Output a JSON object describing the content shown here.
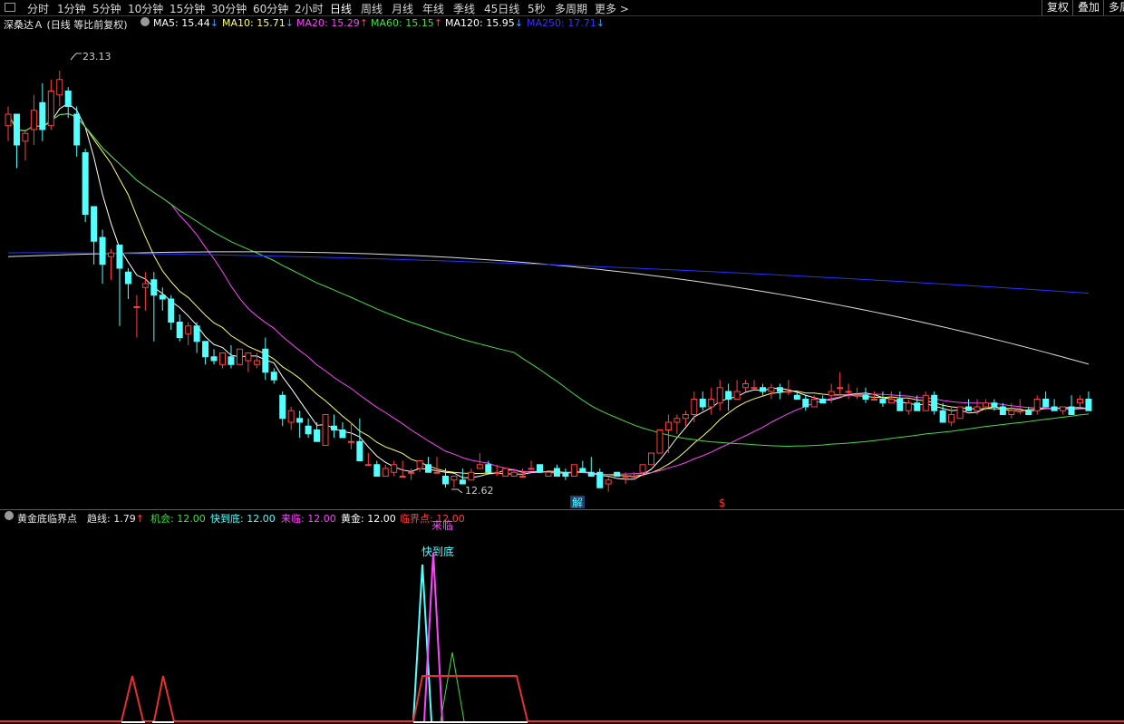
{
  "toolbar": {
    "periods": [
      "分时",
      "1分钟",
      "5分钟",
      "10分钟",
      "15分钟",
      "30分钟",
      "60分钟",
      "2小时",
      "日线",
      "周线",
      "月线",
      "年线",
      "季线",
      "45日线",
      "5秒",
      "多周期",
      "更多 >"
    ],
    "active_period": "日线",
    "right_buttons": [
      "复权",
      "叠加",
      "多周"
    ]
  },
  "main_legend": {
    "title": "深桑达Ａ (日线 等比前复权)",
    "ma5": {
      "label": "MA5: 15.44",
      "dir": "↓",
      "color": "#ffffff"
    },
    "ma10": {
      "label": "MA10: 15.71",
      "dir": "↓",
      "color": "#ffff66"
    },
    "ma20": {
      "label": "MA20: 15.29",
      "dir": "↑",
      "color": "#ff44ff"
    },
    "ma60": {
      "label": "MA60: 15.15",
      "dir": "↑",
      "color": "#44dd44"
    },
    "ma120": {
      "label": "MA120: 15.95",
      "dir": "↓",
      "color": "#ffffff"
    },
    "ma250": {
      "label": "MA250: 17.71",
      "dir": "↓",
      "color": "#3333ff"
    }
  },
  "price_annotations": {
    "high": "23.13",
    "low": "12.62"
  },
  "signal_markers": {
    "jie": "解",
    "dollar": "$"
  },
  "indicator_legend": {
    "title": "黄金底临界点",
    "trend": {
      "label": "趋线: 1.79",
      "dir": "↑"
    },
    "chance": "机会: 12.00",
    "quick_bottom": "快到底: 12.00",
    "coming": "来临: 12.00",
    "gold": "黄金: 12.00",
    "critical": "临界点: 12.00"
  },
  "indicator_labels": {
    "quick_bottom": "快到底",
    "coming": "来临"
  },
  "colors": {
    "bull": "#ff4040",
    "bear": "#54ffff",
    "ma5": "#ffffff",
    "ma10": "#ffff66",
    "ma20": "#ff44ff",
    "ma60": "#44dd44",
    "ma120": "#dddddd",
    "ma250": "#2233ff",
    "quick_bottom": "#54ffff",
    "coming": "#ff44ff",
    "chance": "#44dd44",
    "critical": "#e83030"
  },
  "chart_data": {
    "type": "candlestick",
    "title": "深桑达Ａ (日线 等比前复权)",
    "y_range": [
      12.0,
      24.0
    ],
    "candles": [
      [
        21.7,
        22.2,
        21.3,
        22.0
      ],
      [
        22.0,
        22.0,
        20.6,
        21.2
      ],
      [
        21.3,
        21.6,
        20.8,
        21.5
      ],
      [
        21.6,
        22.5,
        21.2,
        22.1
      ],
      [
        22.3,
        22.8,
        21.3,
        21.6
      ],
      [
        21.7,
        22.9,
        21.6,
        22.6
      ],
      [
        22.5,
        23.13,
        22.2,
        22.9
      ],
      [
        22.6,
        22.7,
        21.9,
        22.2
      ],
      [
        22.0,
        22.2,
        20.9,
        21.2
      ],
      [
        21.0,
        21.1,
        19.2,
        19.4
      ],
      [
        19.6,
        19.6,
        18.1,
        18.7
      ],
      [
        18.8,
        19.0,
        17.6,
        18.1
      ],
      [
        18.3,
        18.5,
        17.7,
        18.4
      ],
      [
        18.6,
        18.6,
        16.5,
        18.0
      ],
      [
        17.9,
        18.0,
        17.2,
        17.6
      ],
      [
        17.0,
        17.3,
        16.2,
        17.0
      ],
      [
        17.5,
        17.9,
        16.9,
        17.6
      ],
      [
        17.7,
        17.9,
        16.1,
        17.3
      ],
      [
        17.3,
        17.5,
        16.9,
        17.2
      ],
      [
        17.2,
        17.3,
        16.4,
        16.6
      ],
      [
        16.6,
        16.8,
        16.1,
        16.2
      ],
      [
        16.3,
        16.6,
        16.0,
        16.5
      ],
      [
        16.5,
        16.6,
        15.8,
        16.1
      ],
      [
        16.1,
        16.1,
        15.5,
        15.7
      ],
      [
        15.7,
        15.9,
        15.5,
        15.6
      ],
      [
        15.5,
        15.8,
        15.4,
        15.8
      ],
      [
        15.7,
        16.0,
        15.4,
        15.5
      ],
      [
        15.5,
        15.9,
        15.5,
        15.9
      ],
      [
        15.6,
        15.8,
        15.3,
        15.8
      ],
      [
        15.5,
        15.8,
        15.4,
        15.6
      ],
      [
        15.9,
        16.2,
        15.1,
        15.3
      ],
      [
        15.3,
        15.4,
        15.0,
        15.1
      ],
      [
        14.7,
        14.8,
        13.9,
        14.1
      ],
      [
        14.0,
        14.4,
        13.8,
        14.3
      ],
      [
        14.1,
        14.3,
        13.6,
        14.0
      ],
      [
        13.9,
        14.1,
        13.6,
        13.7
      ],
      [
        13.8,
        14.0,
        13.5,
        13.5
      ],
      [
        13.4,
        14.2,
        13.4,
        14.2
      ],
      [
        13.9,
        14.2,
        13.6,
        13.8
      ],
      [
        13.8,
        14.0,
        13.6,
        13.6
      ],
      [
        13.5,
        14.0,
        13.3,
        13.5
      ],
      [
        13.5,
        14.1,
        13.1,
        13.0
      ],
      [
        12.9,
        13.2,
        12.9,
        12.9
      ],
      [
        12.9,
        13.0,
        12.6,
        12.6
      ],
      [
        12.6,
        12.9,
        12.62,
        12.8
      ],
      [
        12.7,
        13.0,
        12.6,
        12.9
      ],
      [
        12.6,
        13.0,
        12.6,
        12.6
      ],
      [
        12.7,
        12.8,
        12.5,
        12.7
      ],
      [
        12.8,
        13.0,
        12.7,
        13.0
      ],
      [
        12.9,
        13.1,
        12.7,
        12.7
      ],
      [
        12.7,
        13.1,
        12.7,
        12.7
      ],
      [
        12.6,
        12.8,
        12.3,
        12.4
      ],
      [
        12.5,
        12.6,
        12.3,
        12.6
      ],
      [
        12.5,
        12.8,
        12.4,
        12.4
      ],
      [
        12.5,
        12.8,
        12.5,
        12.7
      ],
      [
        12.8,
        13.2,
        12.8,
        12.9
      ],
      [
        12.9,
        13.0,
        12.7,
        12.7
      ],
      [
        12.7,
        12.9,
        12.6,
        12.7
      ],
      [
        12.6,
        12.8,
        12.6,
        12.8
      ],
      [
        12.6,
        12.8,
        12.7,
        12.7
      ],
      [
        12.6,
        12.8,
        12.6,
        12.6
      ],
      [
        12.8,
        13.0,
        12.8,
        12.8
      ],
      [
        12.9,
        12.9,
        12.7,
        12.7
      ],
      [
        12.6,
        12.7,
        12.6,
        12.7
      ],
      [
        12.8,
        12.9,
        12.6,
        12.6
      ],
      [
        12.7,
        12.8,
        12.5,
        12.6
      ],
      [
        12.6,
        12.9,
        12.6,
        12.9
      ],
      [
        12.8,
        13.0,
        12.7,
        12.7
      ],
      [
        12.7,
        13.1,
        12.7,
        12.6
      ],
      [
        12.7,
        12.8,
        12.3,
        12.3
      ],
      [
        12.4,
        12.6,
        12.2,
        12.5
      ],
      [
        12.7,
        12.7,
        12.6,
        12.6
      ],
      [
        12.6,
        12.7,
        12.4,
        12.6
      ],
      [
        12.6,
        12.7,
        12.5,
        12.6
      ],
      [
        12.7,
        12.9,
        12.6,
        12.9
      ],
      [
        12.9,
        13.0,
        12.9,
        13.2
      ],
      [
        13.2,
        13.8,
        13.2,
        13.8
      ],
      [
        13.8,
        14.2,
        13.2,
        14.0
      ],
      [
        14.0,
        14.2,
        13.7,
        14.1
      ],
      [
        14.1,
        14.3,
        13.9,
        14.2
      ],
      [
        14.2,
        14.8,
        14.0,
        14.6
      ],
      [
        14.6,
        14.8,
        14.3,
        14.4
      ],
      [
        14.4,
        14.9,
        14.2,
        14.6
      ],
      [
        14.5,
        15.1,
        14.3,
        14.9
      ],
      [
        14.8,
        15.0,
        14.3,
        14.6
      ],
      [
        14.6,
        15.1,
        14.6,
        14.8
      ],
      [
        14.9,
        15.1,
        14.8,
        15.0
      ],
      [
        14.9,
        15.1,
        14.9,
        14.9
      ],
      [
        14.9,
        15.0,
        14.7,
        14.8
      ],
      [
        14.8,
        15.0,
        14.6,
        14.9
      ],
      [
        14.9,
        15.0,
        14.6,
        14.8
      ],
      [
        14.8,
        15.1,
        14.7,
        14.8
      ],
      [
        14.7,
        14.8,
        14.6,
        14.6
      ],
      [
        14.6,
        14.7,
        14.3,
        14.4
      ],
      [
        14.4,
        14.7,
        14.4,
        14.6
      ],
      [
        14.6,
        14.7,
        14.5,
        14.5
      ],
      [
        14.7,
        15.0,
        14.5,
        14.8
      ],
      [
        14.9,
        15.3,
        14.7,
        14.9
      ],
      [
        14.8,
        15.0,
        14.6,
        14.8
      ],
      [
        14.7,
        14.9,
        14.6,
        14.7
      ],
      [
        14.7,
        14.9,
        14.5,
        14.6
      ],
      [
        14.6,
        14.8,
        14.6,
        14.6
      ],
      [
        14.6,
        14.8,
        14.4,
        14.5
      ],
      [
        14.5,
        14.8,
        14.5,
        14.6
      ],
      [
        14.6,
        14.8,
        14.3,
        14.3
      ],
      [
        14.3,
        14.6,
        14.2,
        14.5
      ],
      [
        14.5,
        14.7,
        14.3,
        14.3
      ],
      [
        14.3,
        14.8,
        14.3,
        14.7
      ],
      [
        14.7,
        14.8,
        14.2,
        14.3
      ],
      [
        14.3,
        14.5,
        14.0,
        14.0
      ],
      [
        14.0,
        14.4,
        13.9,
        14.2
      ],
      [
        14.1,
        14.4,
        14.1,
        14.4
      ],
      [
        14.4,
        14.6,
        14.3,
        14.3
      ],
      [
        14.3,
        14.6,
        14.2,
        14.4
      ],
      [
        14.4,
        14.6,
        14.3,
        14.5
      ],
      [
        14.5,
        14.6,
        14.3,
        14.4
      ],
      [
        14.4,
        14.5,
        14.2,
        14.2
      ],
      [
        14.2,
        14.5,
        14.1,
        14.3
      ],
      [
        14.3,
        14.6,
        14.2,
        14.3
      ],
      [
        14.3,
        14.4,
        14.2,
        14.2
      ],
      [
        14.3,
        14.7,
        14.2,
        14.6
      ],
      [
        14.6,
        14.8,
        14.5,
        14.4
      ],
      [
        14.4,
        14.6,
        14.3,
        14.3
      ],
      [
        14.3,
        14.4,
        14.2,
        14.4
      ],
      [
        14.4,
        14.7,
        14.3,
        14.2
      ],
      [
        14.5,
        14.7,
        14.4,
        14.6
      ],
      [
        14.6,
        14.8,
        14.3,
        14.3
      ]
    ],
    "moving_averages": [
      {
        "name": "MA5",
        "value": 15.44
      },
      {
        "name": "MA10",
        "value": 15.71
      },
      {
        "name": "MA20",
        "value": 15.29
      },
      {
        "name": "MA60",
        "value": 15.15
      },
      {
        "name": "MA120",
        "value": 15.95
      },
      {
        "name": "MA250",
        "value": 17.71
      }
    ],
    "indicator": {
      "name": "黄金底临界点",
      "series": [
        {
          "name": "趋线",
          "value": 1.79
        },
        {
          "name": "机会",
          "value": 12.0
        },
        {
          "name": "快到底",
          "value": 12.0
        },
        {
          "name": "来临",
          "value": 12.0
        },
        {
          "name": "黄金",
          "value": 12.0
        },
        {
          "name": "临界点",
          "value": 12.0
        }
      ]
    }
  }
}
